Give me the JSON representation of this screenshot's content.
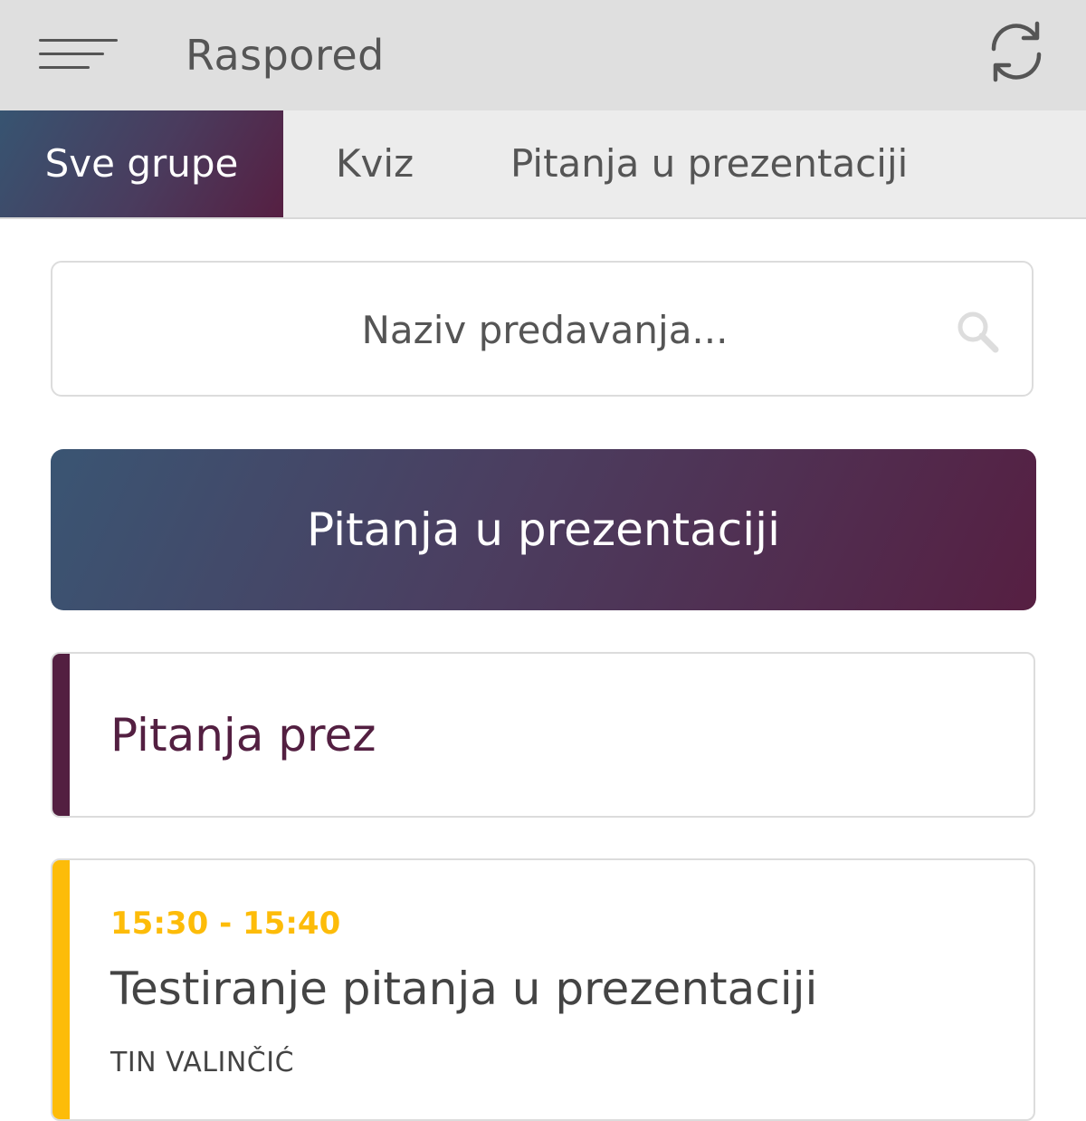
{
  "header": {
    "title": "Raspored",
    "menu_icon": "hamburger-menu-icon",
    "refresh_icon": "refresh-icon"
  },
  "tabs": [
    {
      "label": "Sve grupe",
      "active": true
    },
    {
      "label": "Kviz",
      "active": false
    },
    {
      "label": "Pitanja u prezentaciji",
      "active": false
    }
  ],
  "search": {
    "placeholder": "Naziv predavanja...",
    "value": "",
    "icon": "search-icon"
  },
  "group": {
    "name": "Pitanja u prezentaciji"
  },
  "sessions": [
    {
      "title": "Pitanja prez"
    },
    {
      "time": "15:30 - 15:40",
      "title": "Testiranje pitanja u prezentaciji",
      "speaker": "TIN VALINČIĆ"
    }
  ],
  "colors": {
    "gradient_start": "#375471",
    "gradient_end": "#561f42",
    "accent_purple": "#531f41",
    "accent_yellow": "#fdbc09",
    "topbar_bg": "#dfdfdf",
    "tabs_bg": "#ececec"
  }
}
